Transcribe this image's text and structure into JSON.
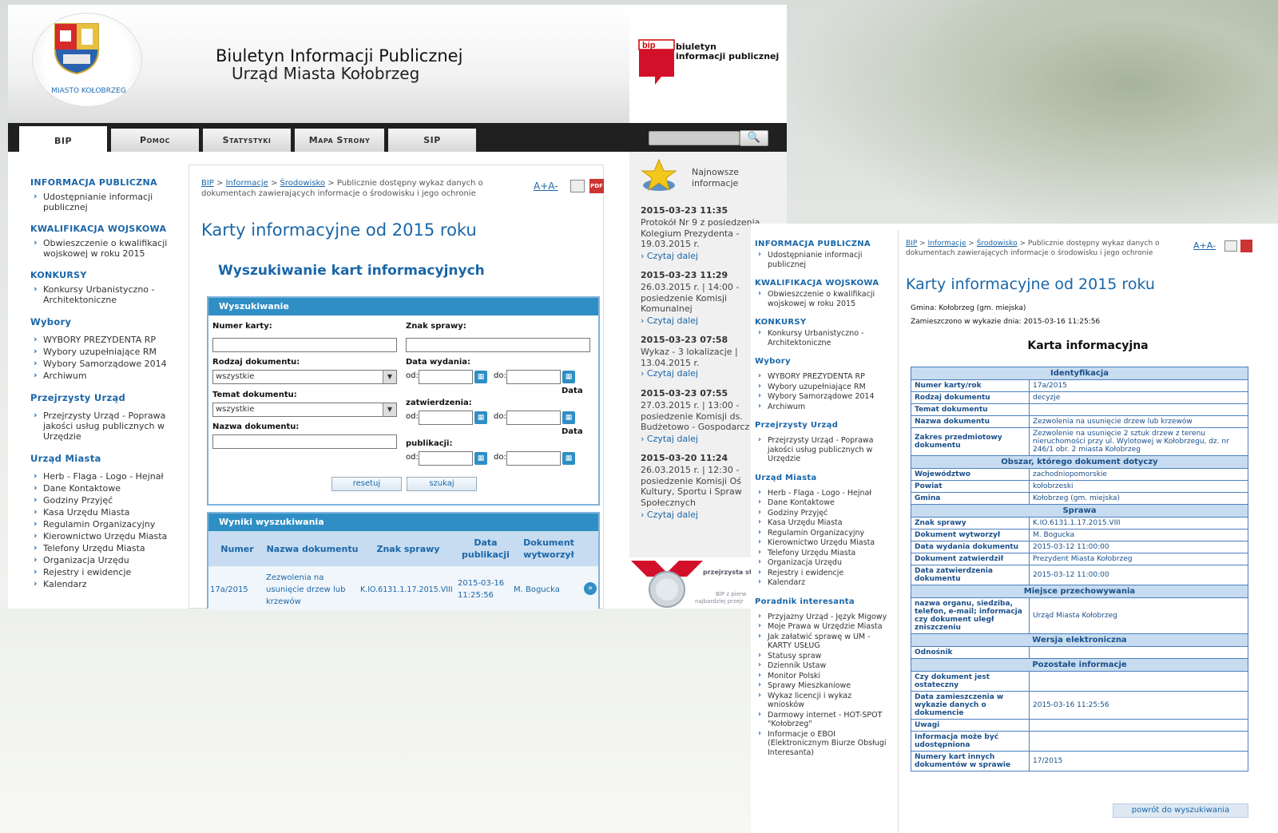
{
  "header": {
    "city_label": "MIASTO KOŁOBRZEG",
    "title_line1": "Biuletyn Informacji Publicznej",
    "title_line2": "Urząd Miasta Kołobrzeg",
    "bip_logo_word": "bip",
    "bip_logo_line1": "biuletyn",
    "bip_logo_line2": "informacji publicznej"
  },
  "nav": {
    "tabs": [
      "BIP",
      "Pomoc",
      "Statystyki",
      "Mapa Strony",
      "SIP"
    ],
    "search_icon": "search-icon"
  },
  "left_menu": {
    "sections": [
      {
        "title": "INFORMACJA PUBLICZNA",
        "items": [
          "Udostępnianie informacji publicznej"
        ]
      },
      {
        "title": "KWALIFIKACJA WOJSKOWA",
        "items": [
          "Obwieszczenie o kwalifikacji wojskowej w roku 2015"
        ]
      },
      {
        "title": "KONKURSY",
        "items": [
          "Konkursy Urbanistyczno - Architektoniczne"
        ]
      },
      {
        "title": "Wybory",
        "items": [
          "WYBORY PREZYDENTA RP",
          "Wybory uzupełniające RM",
          "Wybory Samorządowe 2014",
          "Archiwum"
        ]
      },
      {
        "title": "Przejrzysty Urząd",
        "items": [
          "Przejrzysty Urząd - Poprawa jakości usług publicznych w Urzędzie"
        ]
      },
      {
        "title": "Urząd Miasta",
        "items": [
          "Herb - Flaga - Logo - Hejnał",
          "Dane Kontaktowe",
          "Godziny Przyjęć",
          "Kasa Urzędu Miasta",
          "Regulamin Organizacyjny",
          "Kierownictwo Urzędu Miasta",
          "Telefony Urzędu Miasta",
          "Organizacja Urzędu",
          "Rejestry i ewidencje",
          "Kalendarz"
        ]
      }
    ],
    "extra_section_title": "Poradnik interesanta",
    "extra_items": [
      "Przyjazny Urząd - Język Migowy",
      "Moje Prawa w Urzędzie Miasta",
      "Jak załatwić sprawę w UM - KARTY USŁUG",
      "Statusy spraw",
      "Dziennik Ustaw",
      "Monitor Polski",
      "Sprawy Mieszkaniowe",
      "Wykaz licencji i wykaz wniosków",
      "Darmowy internet - HOT-SPOT \"Kołobrzeg\"",
      "Informacje o EBOI (Elektronicznym Biurze Obsługi Interesanta)"
    ]
  },
  "breadcrumb": {
    "bip": "BIP",
    "sep": ">",
    "informacje": "Informacje",
    "srodowisko": "Środowisko",
    "rest": "> Publicznie dostępny wykaz danych o dokumentach zawierających informacje o środowisku i jego ochronie"
  },
  "font_size_ctrl": "A+A-",
  "pdf_label": "PDF",
  "page_title": "Karty informacyjne od 2015 roku",
  "search_section_title": "Wyszukiwanie kart informacyjnych",
  "search_form": {
    "header": "Wyszukiwanie",
    "numer_karty": "Numer karty:",
    "znak_sprawy": "Znak sprawy:",
    "rodzaj_dokumentu": "Rodzaj dokumentu:",
    "rodzaj_value": "wszystkie",
    "data_wydania": "Data wydania:",
    "temat_dokumentu": "Temat dokumentu:",
    "temat_value": "wszystkie",
    "zatwierdzenia": "zatwierdzenia:",
    "nazwa_dokumentu": "Nazwa dokumentu:",
    "publikacji": "publikacji:",
    "od": "od:",
    "do": "do:",
    "data_word": "Data",
    "reset_btn": "resetuj",
    "search_btn": "szukaj"
  },
  "results": {
    "header": "Wyniki wyszukiwania",
    "columns": [
      "Numer",
      "Nazwa dokumentu",
      "Znak sprawy",
      "Data publikacji",
      "Dokument wytworzył"
    ],
    "rows": [
      {
        "numer": "17a/2015",
        "nazwa": "Zezwolenia na usunięcie drzew lub krzewów",
        "znak": "K.IO.6131.1.17.2015.VIII",
        "data": "2015-03-16 11:25:56",
        "wytworzyl": "M. Bogucka"
      }
    ]
  },
  "news": {
    "title_line1": "Najnowsze",
    "title_line2": "informacje",
    "read_more": "› Czytaj dalej",
    "items": [
      {
        "date": "2015-03-23 11:35",
        "text": "Protokół Nr 9 z posiedzenia\nKolegium Prezydenta -\n19.03.2015 r."
      },
      {
        "date": "2015-03-23 11:29",
        "text": "26.03.2015 r. | 14:00 -\nposiedzenie Komisji\nKomunalnej"
      },
      {
        "date": "2015-03-23 07:58",
        "text": "Wykaz - 3 lokalizacje |\n13.04.2015 r."
      },
      {
        "date": "2015-03-23 07:55",
        "text": "27.03.2015 r. | 13:00 -\nposiedzenie Komisji ds.\nBudżetowo - Gospodarcz"
      },
      {
        "date": "2015-03-20 11:24",
        "text": "26.03.2015 r. | 12:30 -\nposiedzenie Komisji Oś\nKultury, Sportu i Spraw\nSpołecznych"
      }
    ],
    "banner_line1": "przejrzysta stro",
    "banner_line2": "BIP z pierw",
    "banner_line3": "najbardziej przejr"
  },
  "card": {
    "gmina_line": "Gmina: Kołobrzeg (gm. miejska)",
    "zamieszczono_line": "Zamieszczono w wykazie dnia: 2015-03-16 11:25:56",
    "title": "Karta informacyjna",
    "groups": [
      {
        "title": "Identyfikacja",
        "rows": [
          [
            "Numer karty/rok",
            "17a/2015"
          ],
          [
            "Rodzaj dokumentu",
            "decyzje"
          ],
          [
            "Temat dokumentu",
            ""
          ],
          [
            "Nazwa dokumentu",
            "Zezwolenia na usunięcie drzew lub krzewów"
          ],
          [
            "Zakres przedmiotowy dokumentu",
            "Zezwolenie na usunięcie 2 sztuk drzew z terenu nieruchomości przy ul. Wylotowej w Kołobrzegu, dz. nr 246/1 obr. 2 miasta Kołobrzeg"
          ]
        ]
      },
      {
        "title": "Obszar, którego dokument dotyczy",
        "rows": [
          [
            "Województwo",
            "zachodniopomorskie"
          ],
          [
            "Powiat",
            "kołobrzeski"
          ],
          [
            "Gmina",
            "Kołobrzeg (gm. miejska)"
          ]
        ]
      },
      {
        "title": "Sprawa",
        "rows": [
          [
            "Znak sprawy",
            "K.IO.6131.1.17.2015.VIII"
          ],
          [
            "Dokument wytworzył",
            "M. Bogucka"
          ],
          [
            "Data wydania dokumentu",
            "2015-03-12 11:00:00"
          ],
          [
            "Dokument zatwierdził",
            "Prezydent Miasta Kołobrzeg"
          ],
          [
            "Data zatwierdzenia dokumentu",
            "2015-03-12 11:00:00"
          ]
        ]
      },
      {
        "title": "Miejsce przechowywania",
        "rows": [
          [
            "nazwa organu, siedziba, telefon, e-mail; informacja czy dokument uległ zniszczeniu",
            "Urząd Miasta Kołobrzeg"
          ]
        ]
      },
      {
        "title": "Wersja elektroniczna",
        "rows": [
          [
            "Odnośnik",
            ""
          ]
        ]
      },
      {
        "title": "Pozostałe informacje",
        "rows": [
          [
            "Czy dokument jest ostateczny",
            ""
          ],
          [
            "Data zamieszczenia w wykazie danych o dokumencie",
            "2015-03-16 11:25:56"
          ],
          [
            "Uwagi",
            ""
          ],
          [
            "Informacja może być udostępniona",
            ""
          ],
          [
            "Numery kart innych dokumentów w sprawie",
            "17/2015"
          ]
        ]
      }
    ],
    "back_btn": "powrót do wyszukiwania"
  }
}
